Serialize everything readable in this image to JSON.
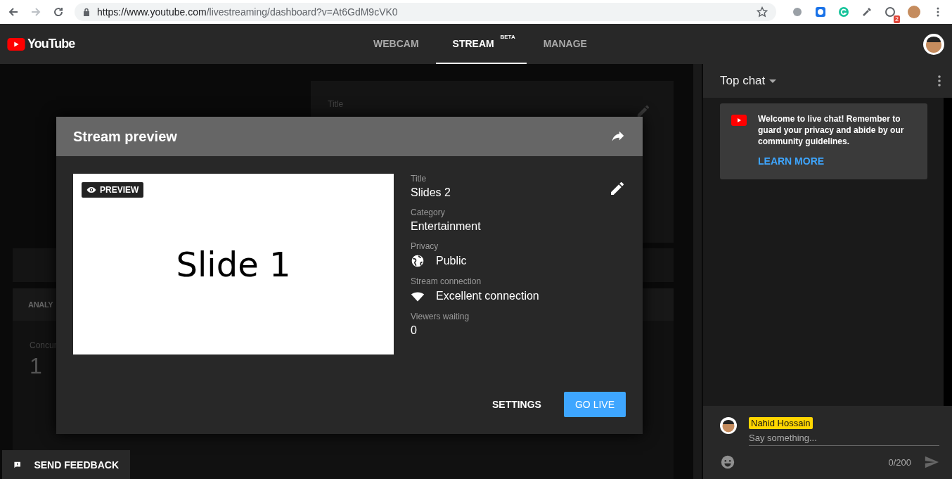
{
  "browser": {
    "url_host": "https://www.youtube.com",
    "url_path": "/livestreaming/dashboard?v=At6GdM9cVK0",
    "extension_badge": "2"
  },
  "header": {
    "logo": "YouTube",
    "tabs": [
      {
        "label": "WEBCAM",
        "selected": false
      },
      {
        "label": "STREAM",
        "selected": true,
        "badge": "BETA"
      },
      {
        "label": "MANAGE",
        "selected": false
      }
    ]
  },
  "dashboard": {
    "title_label": "Title",
    "analytics_header": "ANALY",
    "concurrent_label": "Concur",
    "concurrent_value": "1"
  },
  "modal": {
    "title": "Stream preview",
    "preview_badge": "PREVIEW",
    "slide_text": "Slide 1",
    "fields": [
      {
        "label": "Title",
        "value": "Slides 2",
        "kind": "plain"
      },
      {
        "label": "Category",
        "value": "Entertainment",
        "kind": "plain"
      },
      {
        "label": "Privacy",
        "value": "Public",
        "kind": "globe"
      },
      {
        "label": "Stream connection",
        "value": "Excellent connection",
        "kind": "wifi"
      },
      {
        "label": "Viewers waiting",
        "value": "0",
        "kind": "plain"
      }
    ],
    "buttons": [
      {
        "label": "SETTINGS",
        "kind": "text"
      },
      {
        "label": "GO LIVE",
        "kind": "primary"
      }
    ]
  },
  "feedback": {
    "label": "SEND FEEDBACK"
  },
  "chat": {
    "mode": "Top chat",
    "welcome": "Welcome to live chat! Remember to guard your privacy and abide by our community guidelines.",
    "learn_more": "LEARN MORE",
    "author": "Nahid Hossain",
    "placeholder": "Say something...",
    "counter": "0/200"
  }
}
